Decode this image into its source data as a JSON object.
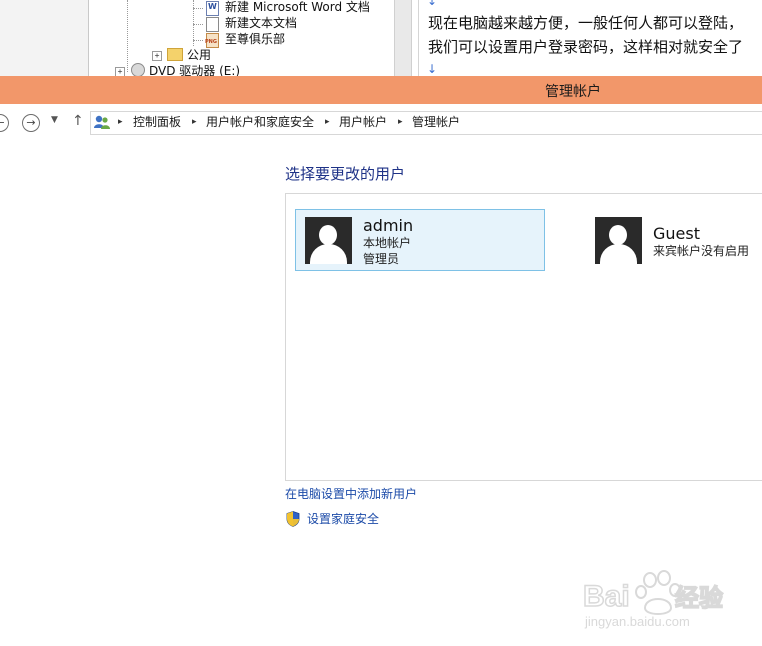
{
  "background_tree": {
    "items": [
      {
        "label": "新建 Microsoft Word 文档",
        "icon": "word-document-icon"
      },
      {
        "label": "新建文本文档",
        "icon": "text-document-icon"
      },
      {
        "label": "至尊俱乐部",
        "icon": "png-file-icon"
      },
      {
        "label": "公用",
        "icon": "folder-icon"
      },
      {
        "label": "DVD 驱动器 (E:)",
        "icon": "dvd-drive-icon"
      }
    ]
  },
  "background_article": {
    "lines": [
      "现在电脑越来越方便，一般任何人都可以登陆，",
      "我们可以设置用户登录密码，这样相对就安全了"
    ]
  },
  "window": {
    "title": "管理帐户",
    "title_color": "#f2976a"
  },
  "breadcrumb": {
    "items": [
      "控制面板",
      "用户帐户和家庭安全",
      "用户帐户",
      "管理帐户"
    ]
  },
  "main": {
    "heading": "选择要更改的用户",
    "accounts": [
      {
        "name": "admin",
        "lines": [
          "本地帐户",
          "管理员"
        ],
        "selected": true
      },
      {
        "name": "Guest",
        "lines": [
          "来宾帐户没有启用"
        ],
        "selected": false
      }
    ],
    "links": {
      "add_user": "在电脑设置中添加新用户",
      "family_safety": "设置家庭安全"
    }
  },
  "watermark": {
    "brand": "Bai du 经验",
    "url": "jingyan.baidu.com"
  }
}
